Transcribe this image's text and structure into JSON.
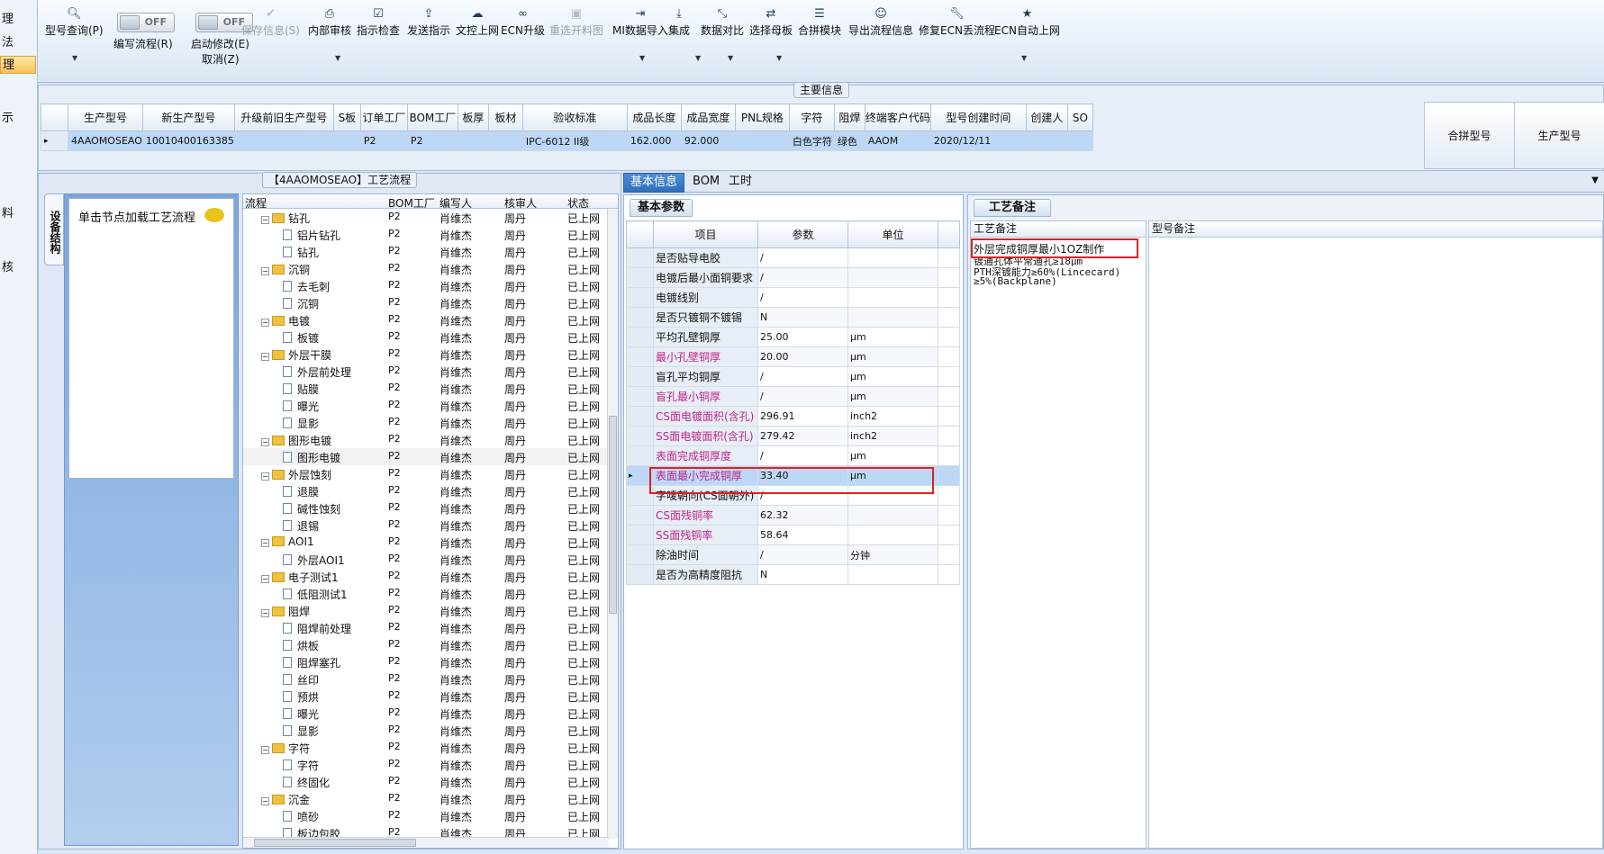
{
  "leftnav": [
    {
      "label": "理",
      "selected": false
    },
    {
      "label": "法",
      "selected": false
    },
    {
      "label": "理",
      "selected": true
    },
    {
      "label": "示",
      "selected": false
    },
    {
      "label": "料",
      "selected": false
    },
    {
      "label": "核",
      "selected": false
    }
  ],
  "toolbar": {
    "items": [
      {
        "label": "型号查询(P)",
        "icon": "search-icon",
        "glyph": "🔍︎",
        "disabled": false
      },
      {
        "label": "保存信息(S)",
        "icon": "check-icon",
        "glyph": "✔",
        "disabled": true
      },
      {
        "label": "内部审核",
        "icon": "print-icon",
        "glyph": "⎙",
        "disabled": false
      },
      {
        "label": "指示检查",
        "icon": "checkbox-icon",
        "glyph": "☑",
        "disabled": false
      },
      {
        "label": "发送指示",
        "icon": "upload-icon",
        "glyph": "⇪",
        "disabled": false
      },
      {
        "label": "文控上网",
        "icon": "cloud-upload-icon",
        "glyph": "☁",
        "disabled": false
      },
      {
        "label": "ECN升级",
        "icon": "binoculars-icon",
        "glyph": "∞",
        "disabled": false
      },
      {
        "label": "重选开料图",
        "icon": "image-icon",
        "glyph": "▣",
        "disabled": true
      },
      {
        "label": "MI数据导入",
        "icon": "sign-in-icon",
        "glyph": "⇥",
        "disabled": false
      },
      {
        "label": "集成",
        "icon": "download-icon",
        "glyph": "⤓",
        "disabled": false
      },
      {
        "label": "数据对比",
        "icon": "compress-icon",
        "glyph": "⤡",
        "disabled": false
      },
      {
        "label": "选择母板",
        "icon": "shuffle-icon",
        "glyph": "⇄",
        "disabled": false
      },
      {
        "label": "合拼模块",
        "icon": "list-icon",
        "glyph": "☰",
        "disabled": false
      },
      {
        "label": "导出流程信息",
        "icon": "smile-icon",
        "glyph": "☺",
        "disabled": false
      },
      {
        "label": "修复ECN丢流程",
        "icon": "wrench-icon",
        "glyph": "🔧︎",
        "disabled": false
      },
      {
        "label": "ECN自动上网",
        "icon": "star-icon",
        "glyph": "★",
        "disabled": false
      }
    ],
    "toggle_write": {
      "state": "OFF",
      "label": "编写流程(R)"
    },
    "toggle_modify": {
      "state": "OFF",
      "label": "启动修改(E)",
      "label2": "取消(Z)"
    }
  },
  "main_info": {
    "title": "主要信息",
    "columns": [
      "生产型号",
      "新生产型号",
      "升级前旧生产型号",
      "S板",
      "订单工厂",
      "BOM工厂",
      "板厚",
      "板材",
      "验收标准",
      "成品长度",
      "成品宽度",
      "PNL规格",
      "字符",
      "阻焊",
      "终端客户代码",
      "型号创建时间",
      "创建人",
      "SO"
    ],
    "row": [
      "4AAOMOSEAO",
      "10010400163385",
      "",
      "",
      "P2",
      "P2",
      "",
      "",
      "IPC-6012 II级",
      "162.000",
      "92.000",
      "",
      "白色字符",
      "绿色",
      "AAOM",
      "2020/12/11",
      "",
      ""
    ],
    "merge_columns": [
      "合拼型号",
      "生产型号"
    ]
  },
  "process_panel": {
    "title": "【4AAOMOSEAO】工艺流程",
    "vertical_tab": "设备结构",
    "node_hint": "单击节点加载工艺流程",
    "tree_columns": [
      "流程",
      "BOM工厂",
      "编写人",
      "核审人",
      "状态"
    ],
    "rows": [
      {
        "name": "钻孔",
        "folder": true,
        "bom": "P2",
        "writer": "肖维杰",
        "reviewer": "周丹",
        "status": "已上网"
      },
      {
        "name": "铝片钻孔",
        "folder": false,
        "bom": "P2",
        "writer": "肖维杰",
        "reviewer": "周丹",
        "status": "已上网"
      },
      {
        "name": "钻孔",
        "folder": false,
        "bom": "P2",
        "writer": "肖维杰",
        "reviewer": "周丹",
        "status": "已上网"
      },
      {
        "name": "沉铜",
        "folder": true,
        "bom": "P2",
        "writer": "肖维杰",
        "reviewer": "周丹",
        "status": "已上网"
      },
      {
        "name": "去毛刺",
        "folder": false,
        "bom": "P2",
        "writer": "肖维杰",
        "reviewer": "周丹",
        "status": "已上网"
      },
      {
        "name": "沉铜",
        "folder": false,
        "bom": "P2",
        "writer": "肖维杰",
        "reviewer": "周丹",
        "status": "已上网"
      },
      {
        "name": "电镀",
        "folder": true,
        "bom": "P2",
        "writer": "肖维杰",
        "reviewer": "周丹",
        "status": "已上网"
      },
      {
        "name": "板镀",
        "folder": false,
        "bom": "P2",
        "writer": "肖维杰",
        "reviewer": "周丹",
        "status": "已上网"
      },
      {
        "name": "外层干膜",
        "folder": true,
        "bom": "P2",
        "writer": "肖维杰",
        "reviewer": "周丹",
        "status": "已上网"
      },
      {
        "name": "外层前处理",
        "folder": false,
        "bom": "P2",
        "writer": "肖维杰",
        "reviewer": "周丹",
        "status": "已上网"
      },
      {
        "name": "贴膜",
        "folder": false,
        "bom": "P2",
        "writer": "肖维杰",
        "reviewer": "周丹",
        "status": "已上网"
      },
      {
        "name": "曝光",
        "folder": false,
        "bom": "P2",
        "writer": "肖维杰",
        "reviewer": "周丹",
        "status": "已上网"
      },
      {
        "name": "显影",
        "folder": false,
        "bom": "P2",
        "writer": "肖维杰",
        "reviewer": "周丹",
        "status": "已上网"
      },
      {
        "name": "图形电镀",
        "folder": true,
        "bom": "P2",
        "writer": "肖维杰",
        "reviewer": "周丹",
        "status": "已上网"
      },
      {
        "name": "图形电镀",
        "folder": false,
        "bom": "P2",
        "writer": "肖维杰",
        "reviewer": "周丹",
        "status": "已上网",
        "selected": true
      },
      {
        "name": "外层蚀刻",
        "folder": true,
        "bom": "P2",
        "writer": "肖维杰",
        "reviewer": "周丹",
        "status": "已上网"
      },
      {
        "name": "退膜",
        "folder": false,
        "bom": "P2",
        "writer": "肖维杰",
        "reviewer": "周丹",
        "status": "已上网"
      },
      {
        "name": "碱性蚀刻",
        "folder": false,
        "bom": "P2",
        "writer": "肖维杰",
        "reviewer": "周丹",
        "status": "已上网"
      },
      {
        "name": "退锡",
        "folder": false,
        "bom": "P2",
        "writer": "肖维杰",
        "reviewer": "周丹",
        "status": "已上网"
      },
      {
        "name": "AOI1",
        "folder": true,
        "bom": "P2",
        "writer": "肖维杰",
        "reviewer": "周丹",
        "status": "已上网"
      },
      {
        "name": "外层AOI1",
        "folder": false,
        "bom": "P2",
        "writer": "肖维杰",
        "reviewer": "周丹",
        "status": "已上网"
      },
      {
        "name": "电子测试1",
        "folder": true,
        "bom": "P2",
        "writer": "肖维杰",
        "reviewer": "周丹",
        "status": "已上网"
      },
      {
        "name": "低阻测试1",
        "folder": false,
        "bom": "P2",
        "writer": "肖维杰",
        "reviewer": "周丹",
        "status": "已上网"
      },
      {
        "name": "阻焊",
        "folder": true,
        "bom": "P2",
        "writer": "肖维杰",
        "reviewer": "周丹",
        "status": "已上网"
      },
      {
        "name": "阻焊前处理",
        "folder": false,
        "bom": "P2",
        "writer": "肖维杰",
        "reviewer": "周丹",
        "status": "已上网"
      },
      {
        "name": "烘板",
        "folder": false,
        "bom": "P2",
        "writer": "肖维杰",
        "reviewer": "周丹",
        "status": "已上网"
      },
      {
        "name": "阻焊塞孔",
        "folder": false,
        "bom": "P2",
        "writer": "肖维杰",
        "reviewer": "周丹",
        "status": "已上网"
      },
      {
        "name": "丝印",
        "folder": false,
        "bom": "P2",
        "writer": "肖维杰",
        "reviewer": "周丹",
        "status": "已上网"
      },
      {
        "name": "预烘",
        "folder": false,
        "bom": "P2",
        "writer": "肖维杰",
        "reviewer": "周丹",
        "status": "已上网"
      },
      {
        "name": "曝光",
        "folder": false,
        "bom": "P2",
        "writer": "肖维杰",
        "reviewer": "周丹",
        "status": "已上网"
      },
      {
        "name": "显影",
        "folder": false,
        "bom": "P2",
        "writer": "肖维杰",
        "reviewer": "周丹",
        "status": "已上网"
      },
      {
        "name": "字符",
        "folder": true,
        "bom": "P2",
        "writer": "肖维杰",
        "reviewer": "周丹",
        "status": "已上网"
      },
      {
        "name": "字符",
        "folder": false,
        "bom": "P2",
        "writer": "肖维杰",
        "reviewer": "周丹",
        "status": "已上网"
      },
      {
        "name": "终固化",
        "folder": false,
        "bom": "P2",
        "writer": "肖维杰",
        "reviewer": "周丹",
        "status": "已上网"
      },
      {
        "name": "沉金",
        "folder": true,
        "bom": "P2",
        "writer": "肖维杰",
        "reviewer": "周丹",
        "status": "已上网"
      },
      {
        "name": "喷砂",
        "folder": false,
        "bom": "P2",
        "writer": "肖维杰",
        "reviewer": "周丹",
        "status": "已上网"
      },
      {
        "name": "板边包胶",
        "folder": false,
        "bom": "P2",
        "writer": "肖维杰",
        "reviewer": "周丹",
        "status": "已上网"
      }
    ]
  },
  "tabs": [
    {
      "label": "基本信息",
      "active": true
    },
    {
      "label": "BOM",
      "active": false
    },
    {
      "label": "工时",
      "active": false
    }
  ],
  "basic_params": {
    "title": "基本参数",
    "columns": [
      "项目",
      "参数",
      "单位"
    ],
    "rows": [
      {
        "item": "是否贴导电胶",
        "value": "/",
        "unit": "",
        "pink": false
      },
      {
        "item": "电镀后最小面铜要求",
        "value": "/",
        "unit": "",
        "pink": false
      },
      {
        "item": "电镀线别",
        "value": "/",
        "unit": "",
        "pink": false
      },
      {
        "item": "是否只镀铜不镀锡",
        "value": "N",
        "unit": "",
        "pink": false
      },
      {
        "item": "平均孔壁铜厚",
        "value": "25.00",
        "unit": "μm",
        "pink": false
      },
      {
        "item": "最小孔壁铜厚",
        "value": "20.00",
        "unit": "μm",
        "pink": true
      },
      {
        "item": "盲孔平均铜厚",
        "value": "/",
        "unit": "μm",
        "pink": false
      },
      {
        "item": "盲孔最小铜厚",
        "value": "/",
        "unit": "μm",
        "pink": true
      },
      {
        "item": "CS面电镀面积(含孔)",
        "value": "296.91",
        "unit": "inch2",
        "pink": true
      },
      {
        "item": "SS面电镀面积(含孔)",
        "value": "279.42",
        "unit": "inch2",
        "pink": true
      },
      {
        "item": "表面完成铜厚度",
        "value": "/",
        "unit": "μm",
        "pink": true
      },
      {
        "item": "表面最小完成铜厚",
        "value": "33.40",
        "unit": "μm",
        "pink": true,
        "selected": true
      },
      {
        "item": "字唛朝向(CS面朝外)",
        "value": "/",
        "unit": "",
        "pink": false
      },
      {
        "item": "CS面残铜率",
        "value": "62.32",
        "unit": "",
        "pink": true
      },
      {
        "item": "SS面残铜率",
        "value": "58.64",
        "unit": "",
        "pink": true
      },
      {
        "item": "除油时间",
        "value": "/",
        "unit": "分钟",
        "pink": false
      },
      {
        "item": "是否为高精度阻抗",
        "value": "N",
        "unit": "",
        "pink": false
      }
    ]
  },
  "process_notes": {
    "title": "工艺备注",
    "col1": "工艺备注",
    "col2": "型号备注",
    "lines": [
      "外层完成铜厚最小1OZ制作",
      "镀通孔体平常通孔≥18μm",
      "PTH深镀能力≥60%(Lincecard)",
      "≥5%(Backplane)"
    ]
  }
}
